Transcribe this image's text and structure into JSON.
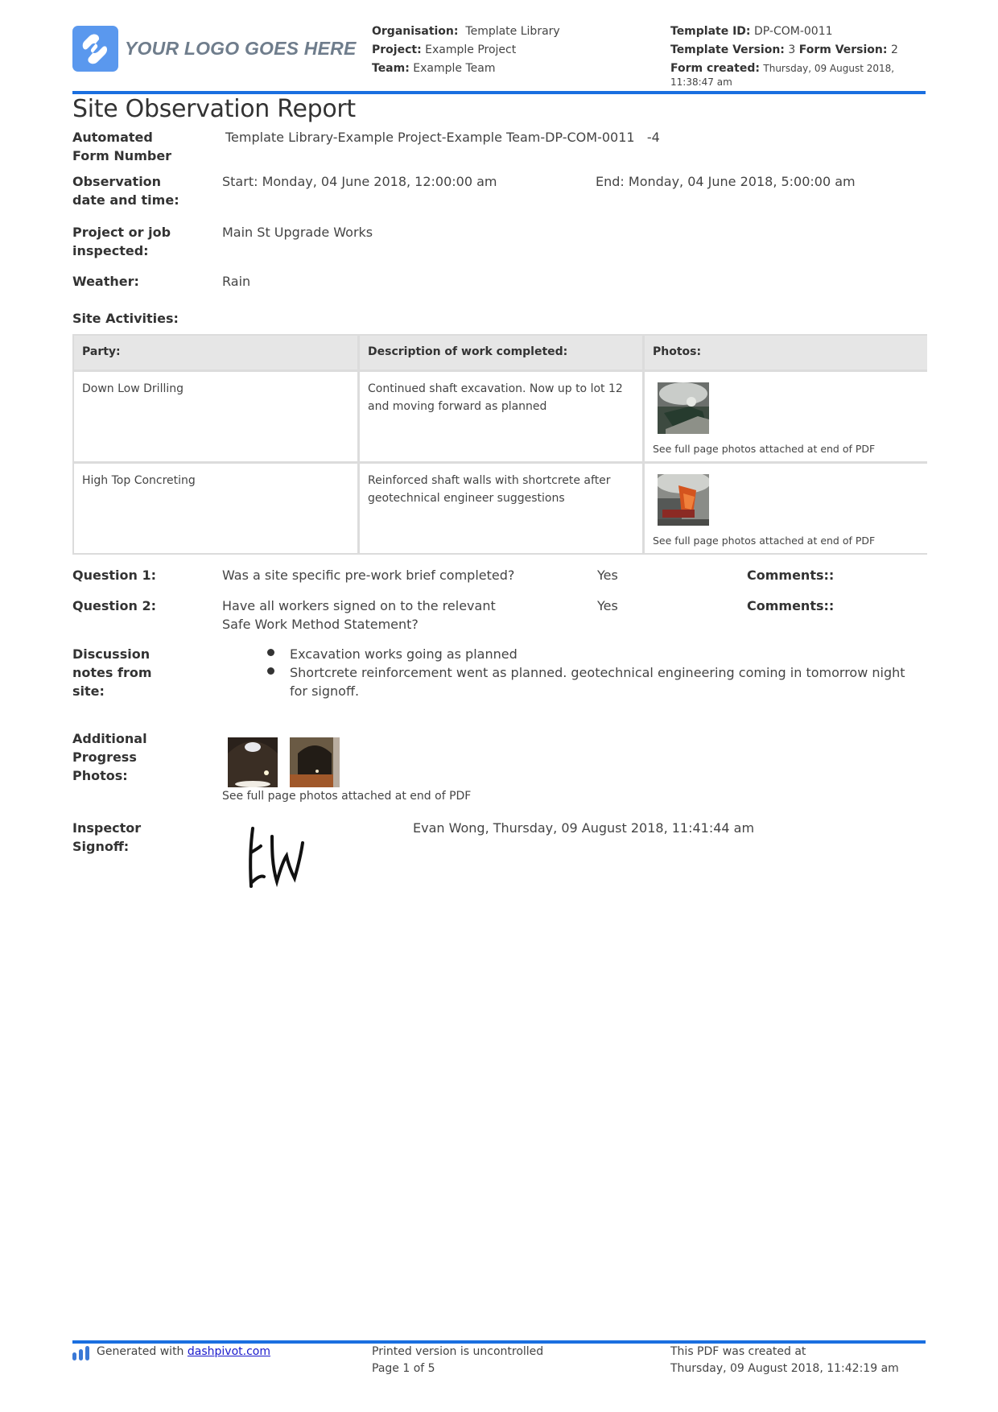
{
  "header": {
    "logo_text": "YOUR LOGO GOES HERE",
    "organisation_label": "Organisation:",
    "organisation_value": "Template Library",
    "project_label": "Project:",
    "project_value": "Example Project",
    "team_label": "Team:",
    "team_value": "Example Team",
    "template_id_label": "Template ID:",
    "template_id_value": "DP-COM-0011",
    "template_version_label": "Template Version:",
    "template_version_value": "3",
    "form_version_label": "Form Version:",
    "form_version_value": "2",
    "form_created_label": "Form created:",
    "form_created_value": "Thursday, 09 August 2018, 11:38:47 am"
  },
  "title": "Site Observation Report",
  "fields": {
    "form_number_label": "Automated Form Number",
    "form_number_value": "Template Library-Example Project-Example Team-DP-COM-0011   -4",
    "observation_label": "Observation date and time:",
    "observation_start": "Start: Monday, 04 June 2018, 12:00:00 am",
    "observation_end": "End: Monday, 04 June 2018, 5:00:00 am",
    "project_label": "Project or job inspected:",
    "project_value": "Main St Upgrade Works",
    "weather_label": "Weather:",
    "weather_value": "Rain",
    "site_activities_label": "Site Activities:"
  },
  "activities_table": {
    "headers": [
      "Party:",
      "Description of work completed:",
      "Photos:"
    ],
    "rows": [
      {
        "party": "Down Low Drilling",
        "description": "Continued shaft excavation. Now up to lot 12 and moving forward as planned",
        "photo_note": "See full page photos attached at end of PDF"
      },
      {
        "party": "High Top Concreting",
        "description": "Reinforced shaft walls with shortcrete after geotechnical engineer suggestions",
        "photo_note": "See full page photos attached at end of PDF"
      }
    ]
  },
  "questions": [
    {
      "label": "Question 1:",
      "text": "Was a site specific pre-work brief completed?",
      "answer": "Yes",
      "comments_label": "Comments::"
    },
    {
      "label": "Question 2:",
      "text": "Have all workers signed on to the relevant Safe Work Method Statement?",
      "answer": "Yes",
      "comments_label": "Comments::"
    }
  ],
  "discussion": {
    "label": "Discussion notes from site:",
    "items": [
      "Excavation works going as planned",
      "Shortcrete reinforcement went as planned. geotechnical engineering coming in tomorrow night for signoff."
    ]
  },
  "additional_photos": {
    "label": "Additional Progress Photos:",
    "note": "See full page photos attached at end of PDF"
  },
  "signoff": {
    "label": "Inspector Signoff:",
    "signature_initials": "EW",
    "value": "Evan Wong, Thursday, 09 August 2018, 11:41:44 am"
  },
  "footer": {
    "generated_prefix": "Generated with",
    "generated_link": "dashpivot.com",
    "uncontrolled": "Printed version is uncontrolled",
    "page": "Page 1 of 5",
    "created_label": "This PDF was created at",
    "created_value": "Thursday, 09 August 2018, 11:42:19 am"
  },
  "colors": {
    "accent_blue": "#1a6fe0",
    "logo_blue": "#5a98ee",
    "table_header_bg": "#e6e6e6",
    "table_border": "#dcdcdc"
  }
}
